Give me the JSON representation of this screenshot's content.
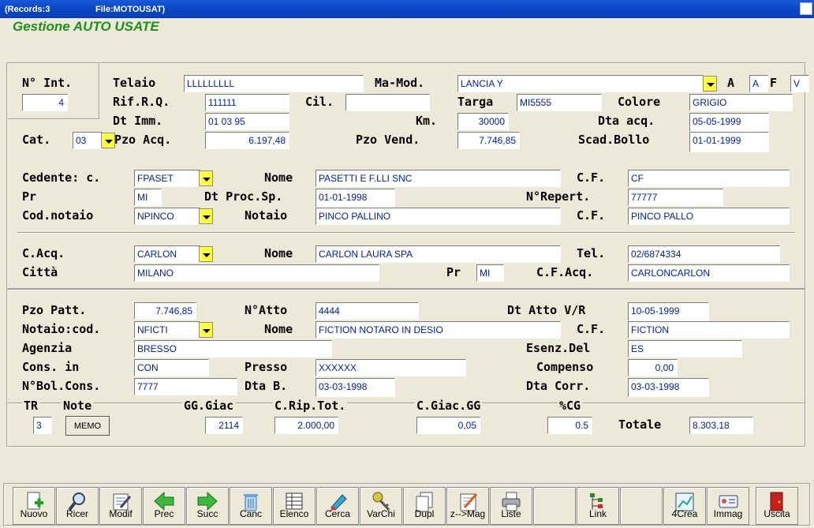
{
  "window": {
    "records": "(Records:3",
    "file": "File:MOTOUSAT)"
  },
  "app_title": "Gestione AUTO USATE",
  "vehicle": {
    "lbl_nint": "N° Int.",
    "nint": "4",
    "lbl_telaio": "Telaio",
    "telaio": "LLLLLLLLL",
    "lbl_mamod": "Ma-Mod.",
    "mamod": "LANCIA Y",
    "lbl_a": "A",
    "a": "A",
    "lbl_f": "F",
    "f": "V",
    "lbl_rifrq": "Rif.R.Q.",
    "rifrq": "111111",
    "lbl_cil": "Cil.",
    "cil": "",
    "lbl_targa": "Targa",
    "targa": "MI5555",
    "lbl_colore": "Colore",
    "colore": "GRIGIO",
    "lbl_dtimm": "Dt Imm.",
    "dtimm": "01 03 95",
    "lbl_km": "Km.",
    "km": "30000",
    "lbl_dtaacq": "Dta acq.",
    "dtaacq": "05-05-1999",
    "lbl_cat": "Cat.",
    "cat": "03",
    "lbl_pzoacq": "Pzo Acq.",
    "pzoacq": "6.197,48",
    "lbl_pzovend": "Pzo Vend.",
    "pzovend": "7.746,85",
    "lbl_scadbollo": "Scad.Bollo",
    "scadbollo": "01-01-1999"
  },
  "seller": {
    "lbl_cedente": "Cedente: c.",
    "cedente": "FPASET",
    "lbl_nome": "Nome",
    "nome": "PASETTI E F.LLI SNC",
    "lbl_cf": "C.F.",
    "cf": "CF",
    "lbl_pr": "Pr",
    "pr": "MI",
    "lbl_dtproc": "Dt Proc.Sp.",
    "dtproc": "01-01-1998",
    "lbl_nrepert": "N°Repert.",
    "nrepert": "77777",
    "lbl_codnotaio": "Cod.notaio",
    "codnotaio": "NPINCO",
    "lbl_notaio": "Notaio",
    "notaio": "PINCO PALLINO",
    "lbl_cf2": "C.F.",
    "cf2": "PINCO PALLO"
  },
  "buyer": {
    "lbl_cacq": "C.Acq.",
    "cacq": "CARLON",
    "lbl_nome": "Nome",
    "nome": "CARLON LAURA SPA",
    "lbl_tel": "Tel.",
    "tel": "02/6874334",
    "lbl_citta": "Città",
    "citta": "MILANO",
    "lbl_pr": "Pr",
    "pr": "MI",
    "lbl_cfacq": "C.F.Acq.",
    "cfacq": "CARLONCARLON"
  },
  "deal": {
    "lbl_pzopatt": "Pzo Patt.",
    "pzopatt": "7.746,85",
    "lbl_natto": "N°Atto",
    "natto": "4444",
    "lbl_dtatto": "Dt Atto V/R",
    "dtatto": "10-05-1999",
    "lbl_notaiocod": "Notaio:cod.",
    "notaiocod": "NFICTI",
    "lbl_nome": "Nome",
    "nome": "FICTION NOTARO IN DESIO",
    "lbl_cf": "C.F.",
    "cf": "FICTION",
    "lbl_agenzia": "Agenzia",
    "agenzia": "BRESSO",
    "lbl_esenz": "Esenz.Del",
    "esenz": "ES",
    "lbl_consin": "Cons. in",
    "consin": "CON",
    "lbl_presso": "Presso",
    "presso": "XXXXXX",
    "lbl_compenso": "Compenso",
    "compenso": "0,00",
    "lbl_nbol": "N°Bol.Cons.",
    "nbol": "7777",
    "lbl_dtab": "Dta B.",
    "dtab": "03-03-1998",
    "lbl_dtacorr": "Dta Corr.",
    "dtacorr": "03-03-1998"
  },
  "summary": {
    "lbl_tr": "TR",
    "tr": "3",
    "lbl_note": "Note",
    "memo": "MEMO",
    "lbl_gggiac": "GG.Giac",
    "gggiac": "2114",
    "lbl_crip": "C.Rip.Tot.",
    "crip": "2.000,00",
    "lbl_cgiac": "C.Giac.GG",
    "cgiac": "0,05",
    "lbl_pcg": "%CG",
    "pcg": "0.5",
    "lbl_totale": "Totale",
    "totale": "8.303,18"
  },
  "toolbar": [
    "Nuovo",
    "Ricer",
    "Modif",
    "Prec",
    "Succ",
    "Canc",
    "Elenco",
    "Cerca",
    "VarChi",
    "Dupl",
    "z-->Mag",
    "Liste",
    "",
    "Link",
    "",
    "4Crea",
    "Immag",
    "Uscita"
  ],
  "toolbar_icons": [
    "new-doc-icon",
    "search-icon",
    "edit-doc-icon",
    "left-arrow-icon",
    "right-arrow-icon",
    "trash-icon",
    "table-icon",
    "marker-icon",
    "keys-icon",
    "duplicate-icon",
    "pencil-doc-icon",
    "printer-icon",
    "",
    "tree-icon",
    "",
    "chart-icon",
    "id-card-icon",
    "exit-door-icon"
  ],
  "colors": {
    "title_green": "#1c8f1c",
    "field_text": "#001e9c",
    "dropdown": "#ffff3a",
    "titlebar": "#0a46c4"
  }
}
